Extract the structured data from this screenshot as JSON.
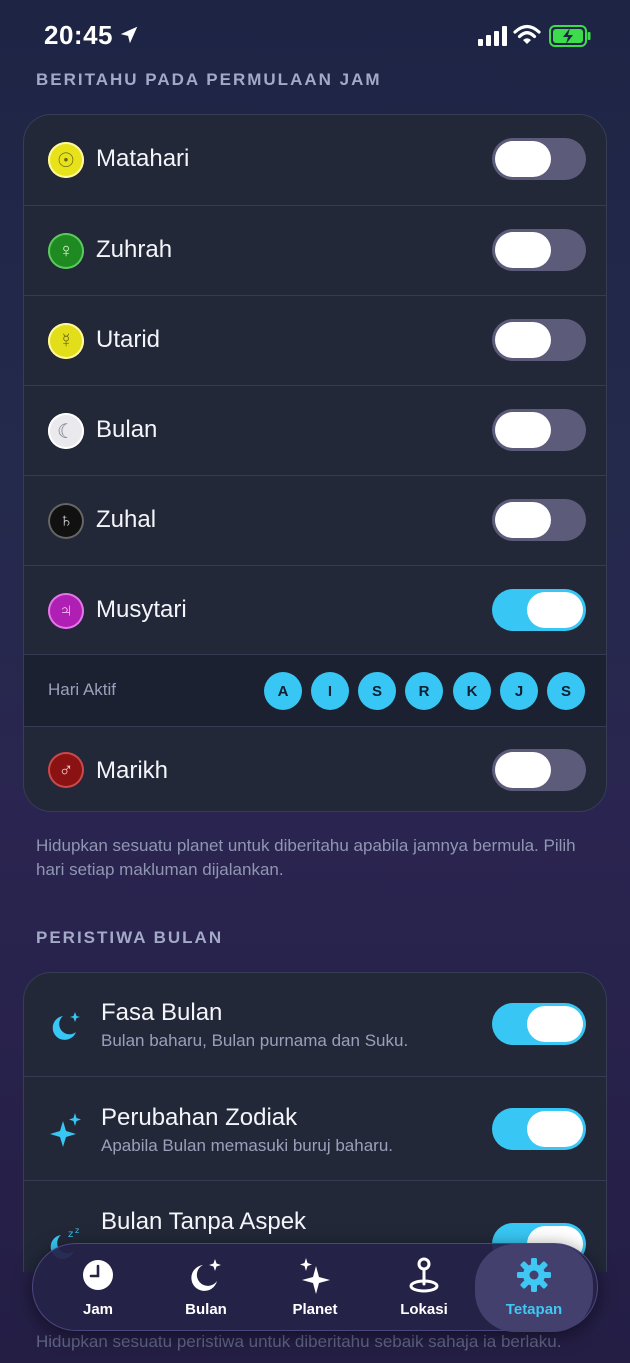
{
  "status": {
    "time": "20:45"
  },
  "section1": {
    "title": "BERITAHU PADA PERMULAAN JAM",
    "planets": [
      {
        "name": "Matahari",
        "icon": "sun-icon",
        "symbol": "☉",
        "color": "#e7e21a",
        "on": false
      },
      {
        "name": "Zuhrah",
        "icon": "venus-icon",
        "symbol": "♀",
        "color": "#1f8a22",
        "on": false
      },
      {
        "name": "Utarid",
        "icon": "mercury-icon",
        "symbol": "☿",
        "color": "#e3de1a",
        "on": false
      },
      {
        "name": "Bulan",
        "icon": "moon-icon",
        "symbol": "☾",
        "color": "#e9e9ee",
        "on": false
      },
      {
        "name": "Zuhal",
        "icon": "saturn-icon",
        "symbol": "♄",
        "color": "#111111",
        "on": false
      },
      {
        "name": "Musytari",
        "icon": "jupiter-icon",
        "symbol": "♃",
        "color": "#b01fb4",
        "on": true
      },
      {
        "name": "Marikh",
        "icon": "mars-icon",
        "symbol": "♂",
        "color": "#8a1212",
        "on": false
      }
    ],
    "active_days_label": "Hari Aktif",
    "days": [
      "A",
      "I",
      "S",
      "R",
      "K",
      "J",
      "S"
    ],
    "footnote": "Hidupkan sesuatu planet untuk diberitahu apabila jamnya bermula. Pilih hari setiap makluman dijalankan."
  },
  "section2": {
    "title": "PERISTIWA BULAN",
    "events": [
      {
        "title": "Fasa Bulan",
        "subtitle": "Bulan baharu, Bulan purnama dan Suku.",
        "on": true
      },
      {
        "title": "Perubahan Zodiak",
        "subtitle": "Apabila Bulan memasuki buruj baharu.",
        "on": true
      },
      {
        "title": "Bulan Tanpa Aspek",
        "subtitle": "",
        "on": true
      }
    ],
    "footnote": "Hidupkan sesuatu peristiwa untuk diberitahu sebaik sahaja ia berlaku."
  },
  "tabs": [
    {
      "label": "Jam",
      "icon": "clock-icon"
    },
    {
      "label": "Bulan",
      "icon": "moon-stars-icon"
    },
    {
      "label": "Planet",
      "icon": "sparkles-icon"
    },
    {
      "label": "Lokasi",
      "icon": "location-pin-icon"
    },
    {
      "label": "Tetapan",
      "icon": "gear-icon",
      "active": true
    }
  ],
  "colors": {
    "accent": "#38c7f4",
    "toggle_off": "#5d5b7a",
    "card": "#222838"
  }
}
